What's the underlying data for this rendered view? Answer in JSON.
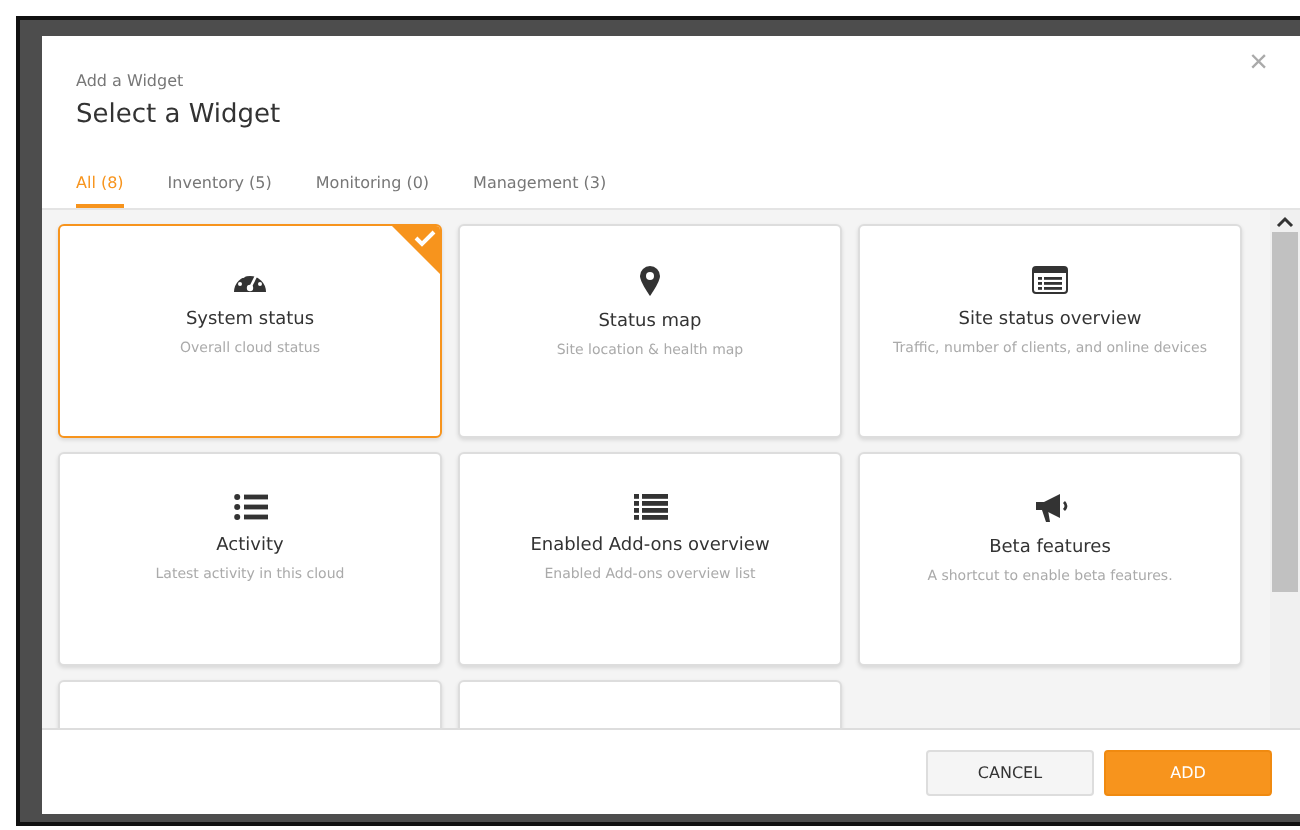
{
  "dialog": {
    "subtitle": "Add a Widget",
    "title": "Select a Widget",
    "close": "×"
  },
  "tabs": [
    {
      "label": "All (8)",
      "selected": true
    },
    {
      "label": "Inventory (5)",
      "selected": false
    },
    {
      "label": "Monitoring (0)",
      "selected": false
    },
    {
      "label": "Management (3)",
      "selected": false
    }
  ],
  "widgets": [
    {
      "kind": "gauge",
      "name": "System status",
      "description": "Overall cloud status",
      "selected": true
    },
    {
      "kind": "pin",
      "name": "Status map",
      "description": "Site location & health map",
      "selected": false
    },
    {
      "kind": "panel",
      "name": "Site status overview",
      "description": "Traffic, number of clients, and online devices",
      "selected": false
    },
    {
      "kind": "bullets",
      "name": "Activity",
      "description": "Latest activity in this cloud",
      "selected": false
    },
    {
      "kind": "rows",
      "name": "Enabled Add-ons overview",
      "description": "Enabled Add-ons overview list",
      "selected": false
    },
    {
      "kind": "megaphone",
      "name": "Beta features",
      "description": "A shortcut to enable beta features.",
      "selected": false
    },
    {
      "kind": "partial",
      "selected": false
    },
    {
      "kind": "partial",
      "selected": false
    }
  ],
  "buttons": [
    {
      "label": "CANCEL",
      "kind": "secondary"
    },
    {
      "label": "ADD",
      "kind": "primary"
    }
  ]
}
